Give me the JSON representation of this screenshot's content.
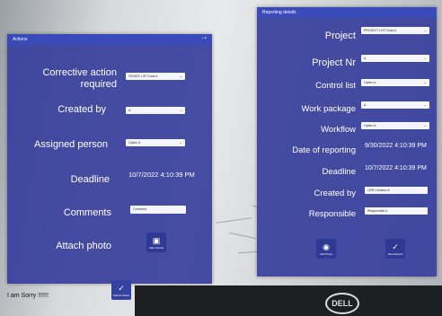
{
  "caption": "I am Sorry !!!!!!",
  "monitor_brand": "DELL",
  "actions_panel": {
    "title": "Actions",
    "labels": {
      "corrective_action": "Corrective action required",
      "created_by": "Created by",
      "assigned_person": "Assigned person",
      "deadline": "Deadline",
      "comments": "Comments",
      "attach_photo": "Attach photo"
    },
    "fields": {
      "corrective_action": "ISSUES LIST Data A",
      "created_by": "A",
      "assigned_person": "Option A"
    },
    "deadline_value": "10/7/2022 4:10:39 PM",
    "comments_placeholder": "Comment",
    "photo_button_label": "Take Picture",
    "submit_button_label": "Submit Action"
  },
  "reporting_panel": {
    "title": "Reporting details",
    "labels": {
      "project": "Project",
      "project_nr": "Project Nr",
      "control_list": "Control list",
      "work_package": "Work package",
      "workflow": "Workflow",
      "date_of_reporting": "Date of reporting",
      "deadline": "Deadline",
      "created_by": "Created by",
      "responsible": "Responsible"
    },
    "fields": {
      "project": "PROJECT LIST Data A",
      "project_nr": "A",
      "control_list": "Option A",
      "work_package": "A",
      "workflow": "Option A",
      "created_by": "USR Creation A",
      "responsible": "Responsible A"
    },
    "date_of_reporting_value": "9/30/2022 4:10:39 PM",
    "deadline_value": "10/7/2022 4:10:39 PM",
    "button_1_label": "Add Photo",
    "button_2_label": "Send Report"
  }
}
